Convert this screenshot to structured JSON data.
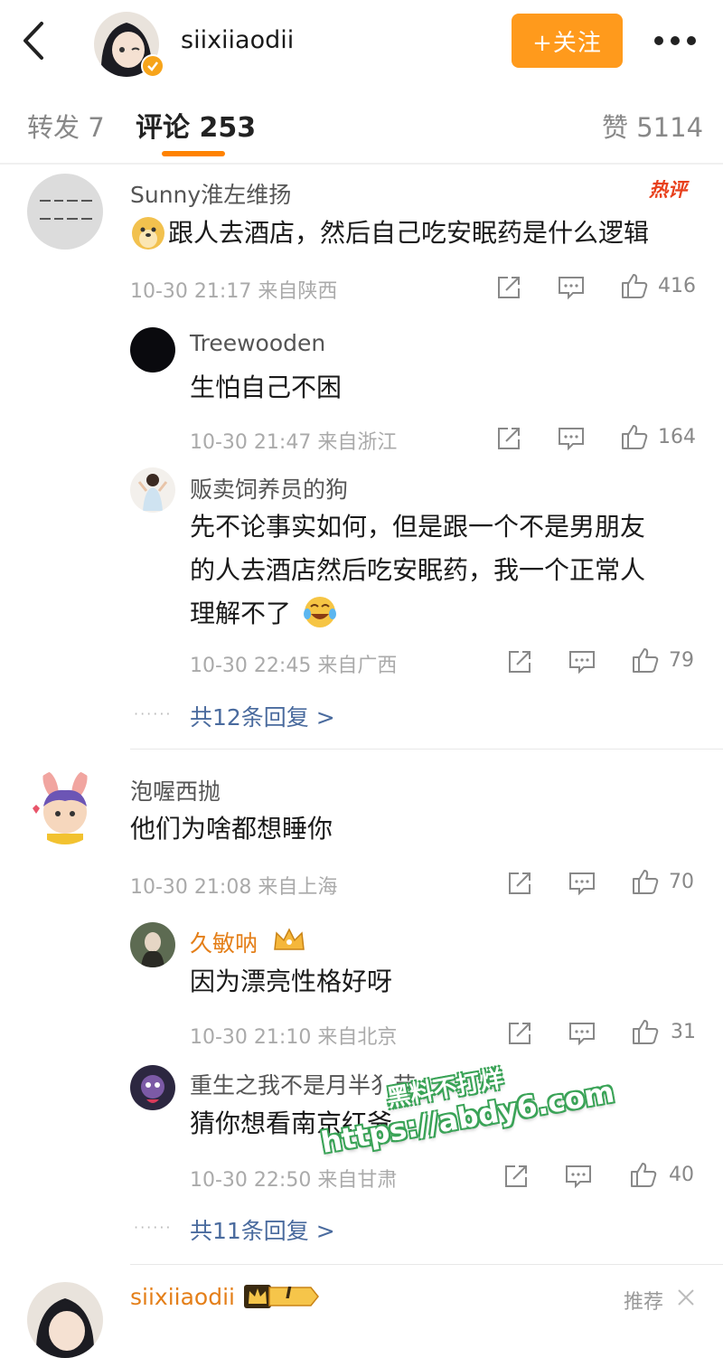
{
  "header": {
    "username": "siixiiaodii",
    "follow_label": "+关注"
  },
  "tabs": {
    "repost": "转发 7",
    "comments": "评论 253",
    "likes": "赞 5114"
  },
  "comments": [
    {
      "name": "Sunny淮左维扬",
      "badge": "热评",
      "text": "跟人去酒店，然后自己吃安眠药是什么逻辑",
      "meta": "10-30 21:17  来自陕西",
      "likes": "416",
      "replies": [
        {
          "name": "Treewooden",
          "text": "生怕自己不困",
          "meta": "10-30 21:47  来自浙江",
          "likes": "164"
        },
        {
          "name": "贩卖饲养员的狗",
          "text_lines": [
            "先不论事实如何，但是跟一个不是男朋友",
            "的人去酒店然后吃安眠药，我一个正常人",
            "理解不了"
          ],
          "meta": "10-30 22:45  来自广西",
          "likes": "79"
        }
      ],
      "more_replies": "共12条回复 >"
    },
    {
      "name": "泡喔西抛",
      "text": "他们为啥都想睡你",
      "meta": "10-30 21:08  来自上海",
      "likes": "70",
      "replies": [
        {
          "name": "久敏呐",
          "text": "因为漂亮性格好呀",
          "meta": "10-30 21:10  来自北京",
          "likes": "31"
        },
        {
          "name": "重生之我不是月半犭苗",
          "text": "猜你想看南京红爷",
          "meta": "10-30 22:50  来自甘肃",
          "likes": "40"
        }
      ],
      "more_replies": "共11条回复 >"
    },
    {
      "name": "siixiiaodii",
      "badge_level": "I",
      "recommend": "推荐"
    }
  ],
  "watermark": {
    "line1": "黑料不打烊",
    "line2": "https://abdy6.com"
  },
  "colors": {
    "accent": "#ff8200",
    "follow": "#ff9a1c",
    "link": "#4a6b9e",
    "watermark_outline": "#3aa357"
  }
}
